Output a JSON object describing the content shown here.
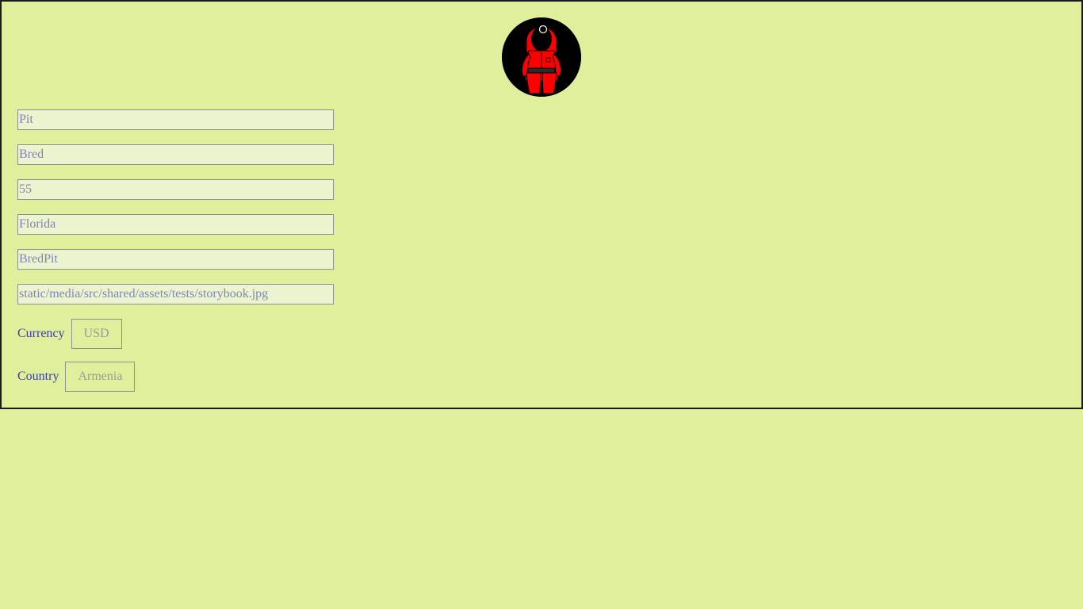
{
  "profile": {
    "avatar_icon": "red-jumpsuit-guard-avatar",
    "fields": {
      "first_name": "Pit",
      "last_name": "Bred",
      "age": "55",
      "city": "Florida",
      "username": "BredPit",
      "avatar_path": "static/media/src/shared/assets/tests/storybook.jpg"
    },
    "currency": {
      "label": "Currency",
      "value": "USD"
    },
    "country": {
      "label": "Country",
      "value": "Armenia"
    }
  },
  "colors": {
    "page_background": "#e0ef9c",
    "input_background": "#ecf4cf",
    "input_text": "#7f86b6",
    "label_text": "#3a3fa8",
    "card_border": "#1b1b1b",
    "avatar_red": "#ff0000"
  }
}
